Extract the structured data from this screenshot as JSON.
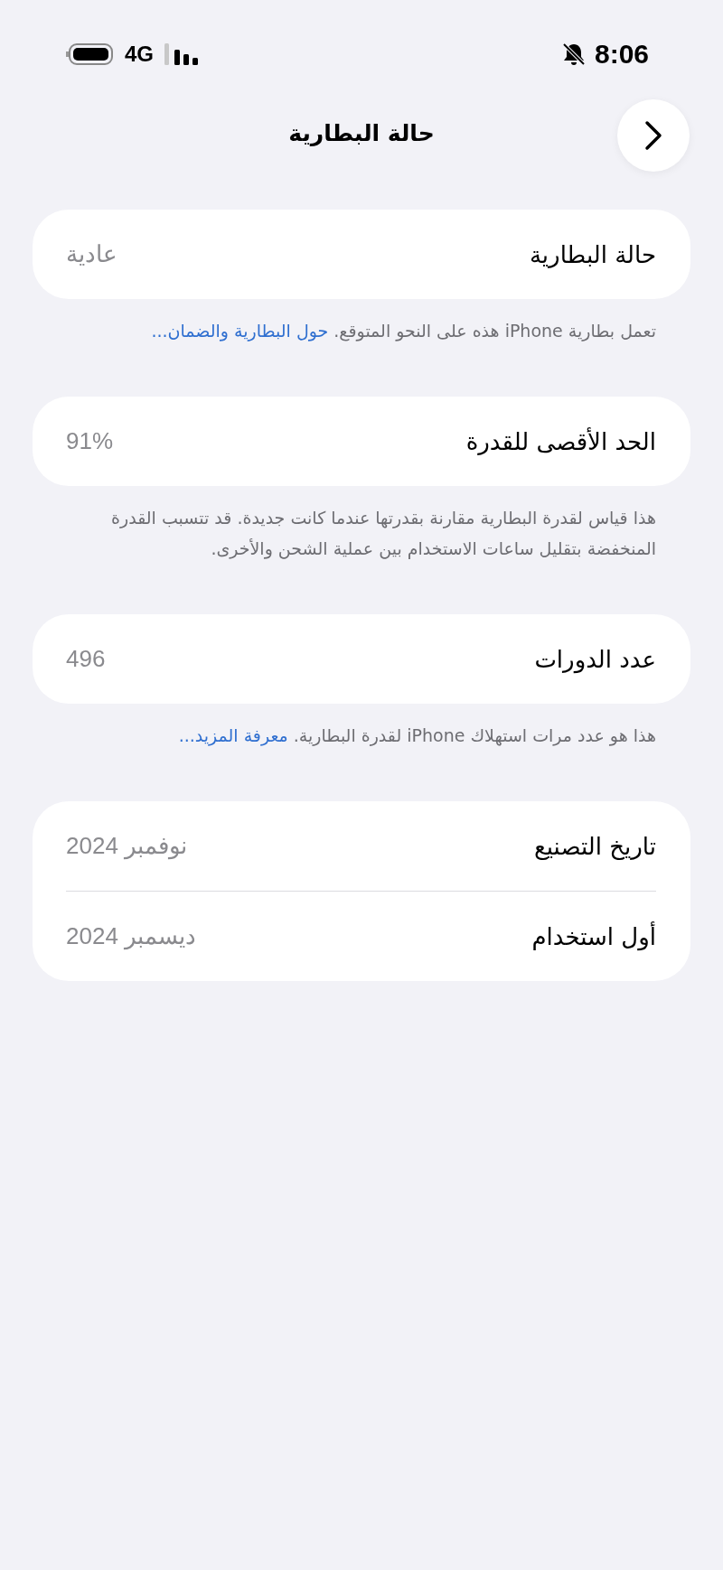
{
  "status_bar": {
    "time": "8:06",
    "network": "4G"
  },
  "nav": {
    "title": "حالة البطارية"
  },
  "sections": [
    {
      "rows": [
        {
          "label": "حالة البطارية",
          "value": "عادية"
        }
      ],
      "note": {
        "text": "تعمل بطارية iPhone هذه على النحو المتوقع.",
        "link": "حول البطارية والضمان..."
      }
    },
    {
      "rows": [
        {
          "label": "الحد الأقصى للقدرة",
          "value": "91%"
        }
      ],
      "note": {
        "text": "هذا قياس لقدرة البطارية مقارنة بقدرتها عندما كانت جديدة. قد تتسبب القدرة المنخفضة بتقليل ساعات الاستخدام بين عملية الشحن والأخرى."
      }
    },
    {
      "rows": [
        {
          "label": "عدد الدورات",
          "value": "496"
        }
      ],
      "note": {
        "text": "هذا هو عدد مرات استهلاك iPhone لقدرة البطارية.",
        "link": "معرفة المزيد..."
      }
    },
    {
      "rows": [
        {
          "label": "تاريخ التصنيع",
          "value": "نوفمبر 2024"
        },
        {
          "label": "أول استخدام",
          "value": "ديسمبر 2024"
        }
      ]
    }
  ]
}
